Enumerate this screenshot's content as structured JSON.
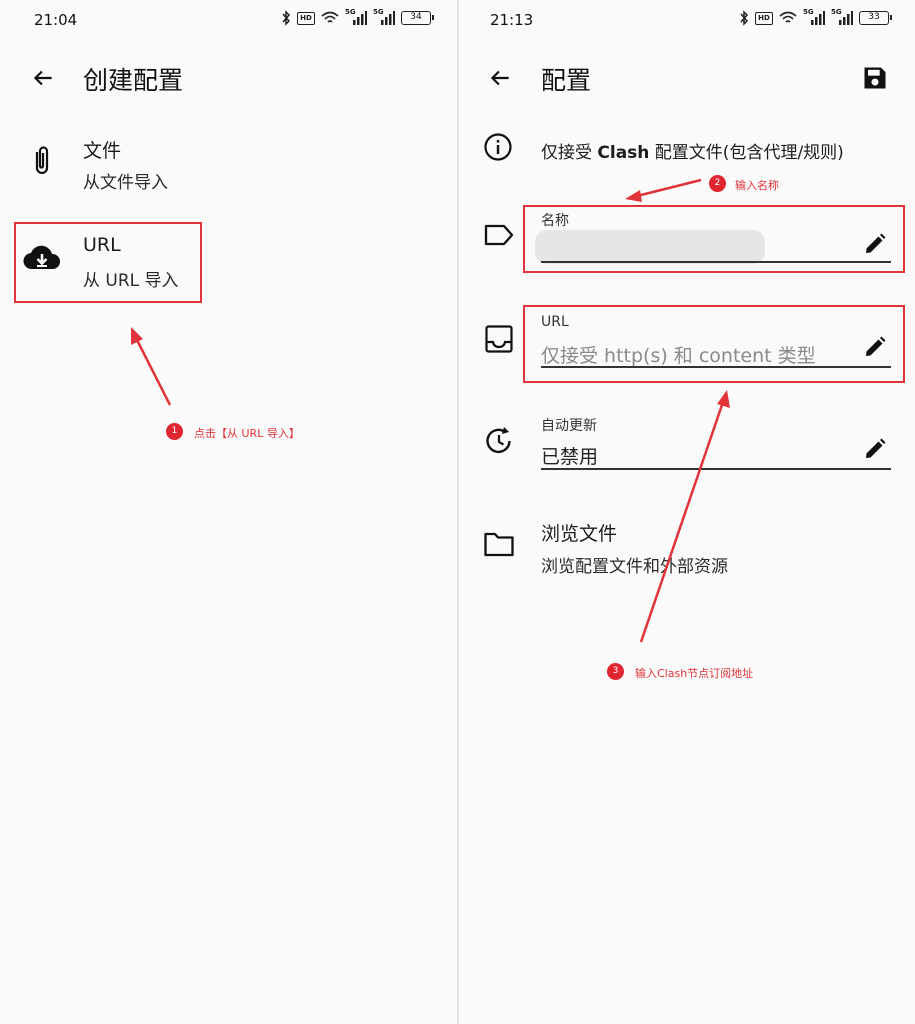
{
  "left": {
    "status_time": "21:04",
    "battery": "34",
    "title": "创建配置",
    "items": [
      {
        "title": "文件",
        "subtitle": "从文件导入",
        "icon": "paperclip-icon"
      },
      {
        "title": "URL",
        "subtitle": "从 URL 导入",
        "icon": "cloud-download-icon"
      }
    ],
    "annotation": {
      "number": "1",
      "text": "点击【从 URL 导入】"
    }
  },
  "right": {
    "status_time": "21:13",
    "battery": "33",
    "title": "配置",
    "info_text_prefix": "仅接受 ",
    "info_text_bold": "Clash",
    "info_text_suffix": " 配置文件(包含代理/规则)",
    "name_field": {
      "label": "名称",
      "value": ""
    },
    "url_field": {
      "label": "URL",
      "placeholder": "仅接受 http(s) 和 content 类型"
    },
    "auto_update": {
      "label": "自动更新",
      "value": "已禁用"
    },
    "browse": {
      "title": "浏览文件",
      "subtitle": "浏览配置文件和外部资源"
    },
    "annotations": [
      {
        "number": "2",
        "text": "输入名称"
      },
      {
        "number": "3",
        "text": "输入Clash节点订阅地址"
      }
    ]
  },
  "status_icons": {
    "network_label": "5G",
    "hd_label": "HD"
  },
  "colors": {
    "annotation_red": "#e0343a",
    "badge_red": "#e02631",
    "background": "#fafafa"
  }
}
